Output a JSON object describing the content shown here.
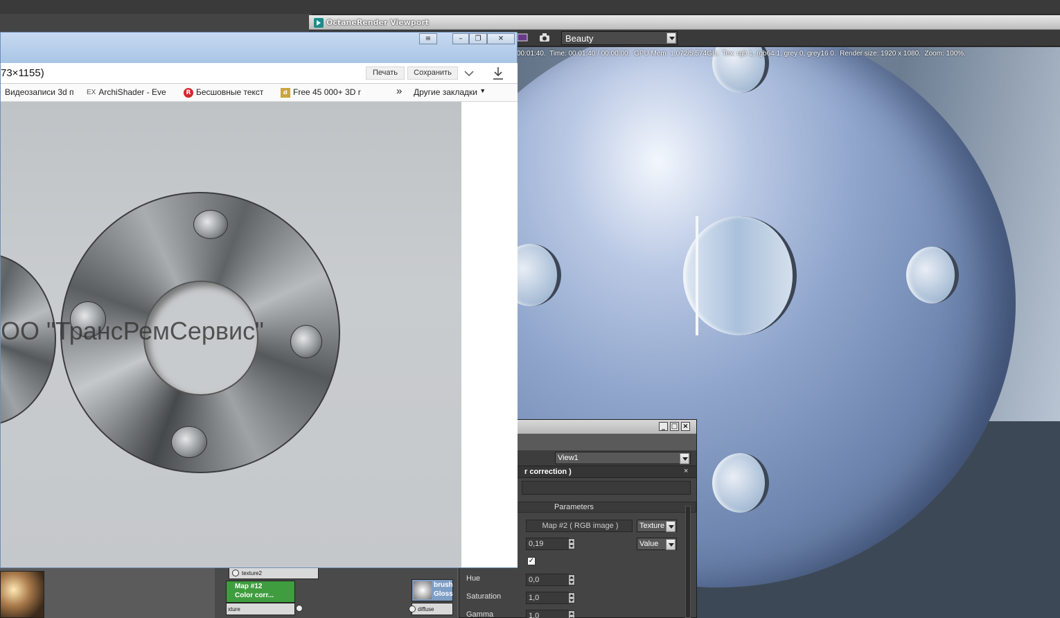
{
  "octane": {
    "window_title": "OctaneRender Viewport",
    "pass_select": "Beauty",
    "render_info": "00:01:40.  Time: 00:01:40 / 00:00:00.  GPU Mem: 1,072/5,574GB.  Tex: rgb 1, rgb64 1, grey 0, grey16 0.  Render size: 1920 x 1080.  Zoom: 100%."
  },
  "material_panel": {
    "view_select": "View1",
    "header_title": "r correction )",
    "section_title": "Parameters",
    "map_button": "Map #2  ( RGB image )",
    "map_type_select": "Texture",
    "value_field": "0,19",
    "value_type_select": "Value",
    "checkbox_checked": true,
    "fields": [
      {
        "label": "Hue",
        "value": "0,0"
      },
      {
        "label": "Saturation",
        "value": "1,0"
      },
      {
        "label": "Gamma",
        "value": "1,0"
      }
    ]
  },
  "slate": {
    "node_map12_line1": "Map #12",
    "node_map12_line2": "Color corr...",
    "socket_texture2": "texture2",
    "socket_texture": "xture",
    "node_brush_line1": "brush",
    "node_brush_line2": "Gloss",
    "socket_diffuse": "diffuse"
  },
  "browser": {
    "address_text": "73×1155)",
    "print_button": "Печать",
    "save_button": "Сохранить",
    "bookmarks": [
      {
        "label": "Видеозаписи 3d п",
        "icon": "folder-icon"
      },
      {
        "label": "ArchiShader - Eve",
        "icon": "ex-icon",
        "prefix": "EX"
      },
      {
        "label": "Бесшовные текст",
        "icon": "red-r-icon"
      },
      {
        "label": "Free 45 000+ 3D r",
        "icon": "a-icon"
      }
    ],
    "bookmarks_more": "»",
    "other_bookmarks": "Другие закладки",
    "photo_caption": "ОО \"ТрансРемСервис\""
  }
}
